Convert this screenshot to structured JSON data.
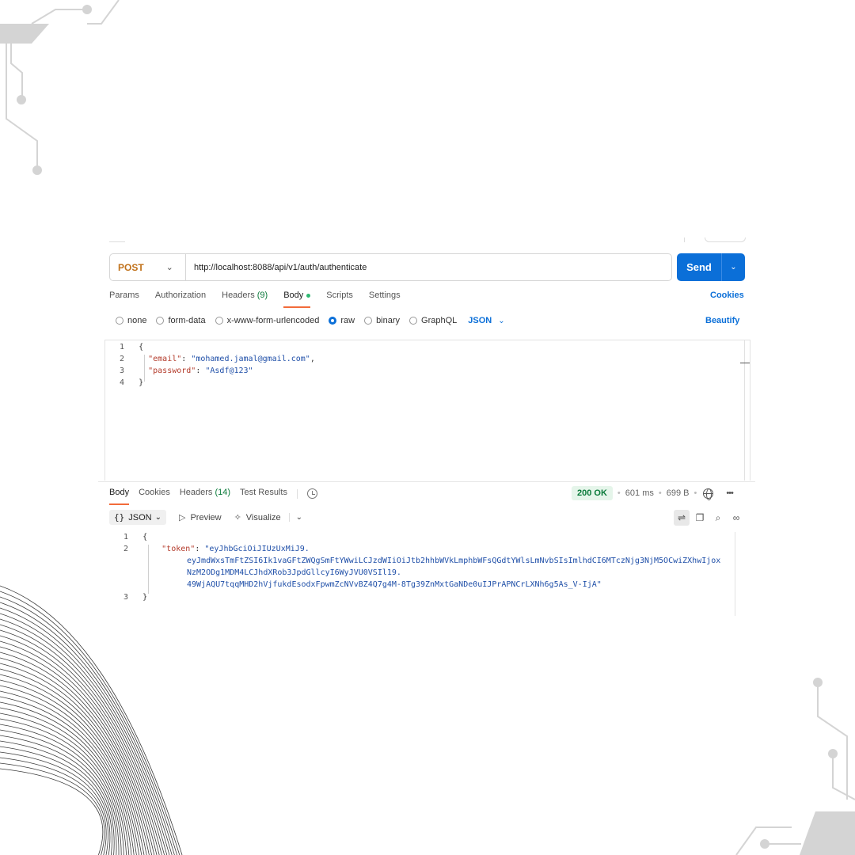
{
  "request": {
    "method": "POST",
    "url": "http://localhost:8088/api/v1/auth/authenticate",
    "send_label": "Send",
    "tabs": [
      {
        "label": "Params"
      },
      {
        "label": "Authorization"
      },
      {
        "label": "Headers",
        "count": "(9)"
      },
      {
        "label": "Body"
      },
      {
        "label": "Scripts"
      },
      {
        "label": "Settings"
      }
    ],
    "cookies_label": "Cookies",
    "body_types": [
      "none",
      "form-data",
      "x-www-form-urlencoded",
      "raw",
      "binary",
      "GraphQL"
    ],
    "body_type_selected": "raw",
    "language": "JSON",
    "beautify_label": "Beautify",
    "body_lines": [
      {
        "num": "1",
        "text": "{"
      },
      {
        "num": "2",
        "key": "\"email\"",
        "sep": ": ",
        "value": "\"mohamed.jamal@gmail.com\"",
        "end": ","
      },
      {
        "num": "3",
        "key": "\"password\"",
        "sep": ": ",
        "value": "\"Asdf@123\""
      },
      {
        "num": "4",
        "text": "}"
      }
    ]
  },
  "response": {
    "tabs": [
      {
        "label": "Body"
      },
      {
        "label": "Cookies"
      },
      {
        "label": "Headers",
        "count": "(14)"
      },
      {
        "label": "Test Results"
      }
    ],
    "status": "200 OK",
    "time": "601 ms",
    "size": "699 B",
    "more": "•••",
    "format": "JSON",
    "format_braces": "{}",
    "preview_label": "Preview",
    "visualize_label": "Visualize",
    "lines": [
      {
        "num": "1",
        "text": "{"
      },
      {
        "num": "2",
        "key": "\"token\"",
        "sep": ": ",
        "value_parts": [
          "\"eyJhbGciOiJIUzUxMiJ9.",
          "eyJmdWxsTmFtZSI6Ik1vaGFtZWQgSmFtYWwiLCJzdWIiOiJtb2hhbWVkLmphbWFsQGdtYWlsLmNvbSIsImlhdCI6MTczNjg3NjM5OCwiZXhwIjox",
          "NzM2ODg1MDM4LCJhdXRob3JpdGllcyI6WyJVU0VSIl19.",
          "49WjAQU7tqqMHD2hVjfukdEsodxFpwmZcNVvBZ4Q7g4M-8Tg39ZnMxtGaNDe0uIJPrAPNCrLXNh6g5As_V-IjA\""
        ]
      },
      {
        "num": "3",
        "text": "}"
      }
    ]
  },
  "colors": {
    "send": "#0b6fd8",
    "method": "#c1721b",
    "tab_underline": "#f26b3a",
    "status_ok_bg": "#e5f5ea",
    "status_ok_fg": "#0a7a3a",
    "json_key": "#b33a2a",
    "json_string": "#1f4fa8"
  }
}
